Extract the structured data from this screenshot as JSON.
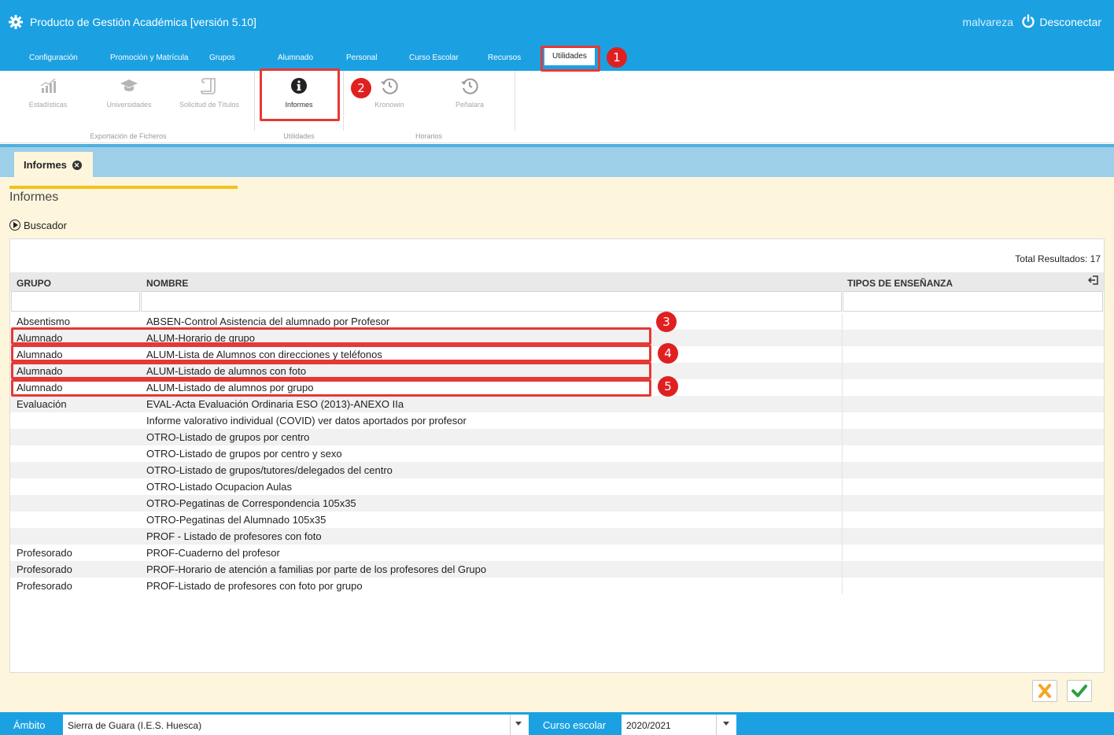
{
  "app": {
    "title": "Producto de Gestión Académica [versión 5.10]",
    "user": "malvareza",
    "logout_label": "Desconectar"
  },
  "menu": [
    {
      "label": "Configuración"
    },
    {
      "label": "Promoción y Matrícula"
    },
    {
      "label": "Grupos"
    },
    {
      "label": "Alumnado"
    },
    {
      "label": "Personal"
    },
    {
      "label": "Curso Escolar"
    },
    {
      "label": "Recursos"
    },
    {
      "label": "Utilidades",
      "active": true
    }
  ],
  "ribbon": {
    "buttons": [
      {
        "label": "Estadísticas",
        "icon": "chart-icon"
      },
      {
        "label": "Universidades",
        "icon": "graduation-cap-icon"
      },
      {
        "label": "Solicitud de Títulos",
        "icon": "scroll-icon"
      },
      {
        "label": "Informes",
        "icon": "info-icon",
        "active": true
      },
      {
        "label": "Kronowin",
        "icon": "history-icon"
      },
      {
        "label": "Peñalara",
        "icon": "history-icon"
      }
    ],
    "groups": [
      "Exportación de Ficheros",
      "Utilidades",
      "Horarios"
    ]
  },
  "tab": {
    "label": "Informes"
  },
  "section": {
    "title": "Informes",
    "search_label": "Buscador",
    "total_results": "Total Resultados: 17"
  },
  "table": {
    "columns": [
      "GRUPO",
      "NOMBRE",
      "TIPOS DE ENSEÑANZA"
    ],
    "rows": [
      {
        "grupo": "Absentismo",
        "nombre": "ABSEN-Control Asistencia del alumnado por Profesor"
      },
      {
        "grupo": "Alumnado",
        "nombre": "ALUM-Horario de grupo"
      },
      {
        "grupo": "Alumnado",
        "nombre": "ALUM-Lista de Alumnos con direcciones y teléfonos"
      },
      {
        "grupo": "Alumnado",
        "nombre": "ALUM-Listado de alumnos con foto"
      },
      {
        "grupo": "Alumnado",
        "nombre": "ALUM-Listado de alumnos por grupo"
      },
      {
        "grupo": "Evaluación",
        "nombre": "EVAL-Acta Evaluación Ordinaria ESO (2013)-ANEXO IIa"
      },
      {
        "grupo": "",
        "nombre": "Informe valorativo individual (COVID) ver datos aportados por profesor"
      },
      {
        "grupo": "",
        "nombre": "OTRO-Listado de grupos por centro"
      },
      {
        "grupo": "",
        "nombre": "OTRO-Listado de grupos por centro y sexo"
      },
      {
        "grupo": "",
        "nombre": "OTRO-Listado de grupos/tutores/delegados del centro"
      },
      {
        "grupo": "",
        "nombre": "OTRO-Listado Ocupacion Aulas"
      },
      {
        "grupo": "",
        "nombre": "OTRO-Pegatinas de Correspondencia 105x35"
      },
      {
        "grupo": "",
        "nombre": "OTRO-Pegatinas del Alumnado 105x35"
      },
      {
        "grupo": "",
        "nombre": "PROF - Listado de profesores con foto"
      },
      {
        "grupo": "Profesorado",
        "nombre": "PROF-Cuaderno del profesor"
      },
      {
        "grupo": "Profesorado",
        "nombre": "PROF-Horario de atención a familias por parte de los profesores del Grupo"
      },
      {
        "grupo": "Profesorado",
        "nombre": "PROF-Listado de profesores con foto por grupo"
      }
    ]
  },
  "badges": [
    "1",
    "2",
    "3",
    "4",
    "5"
  ],
  "statusbar": {
    "ambito_label": "Ámbito",
    "ambito_value": "Sierra de Guara (I.E.S. Huesca)",
    "curso_label": "Curso escolar",
    "curso_value": "2020/2021"
  },
  "colors": {
    "brand": "#1ba1e2",
    "highlight": "#e53935",
    "cancel": "#f5a623",
    "accept": "#2e9e3e"
  }
}
